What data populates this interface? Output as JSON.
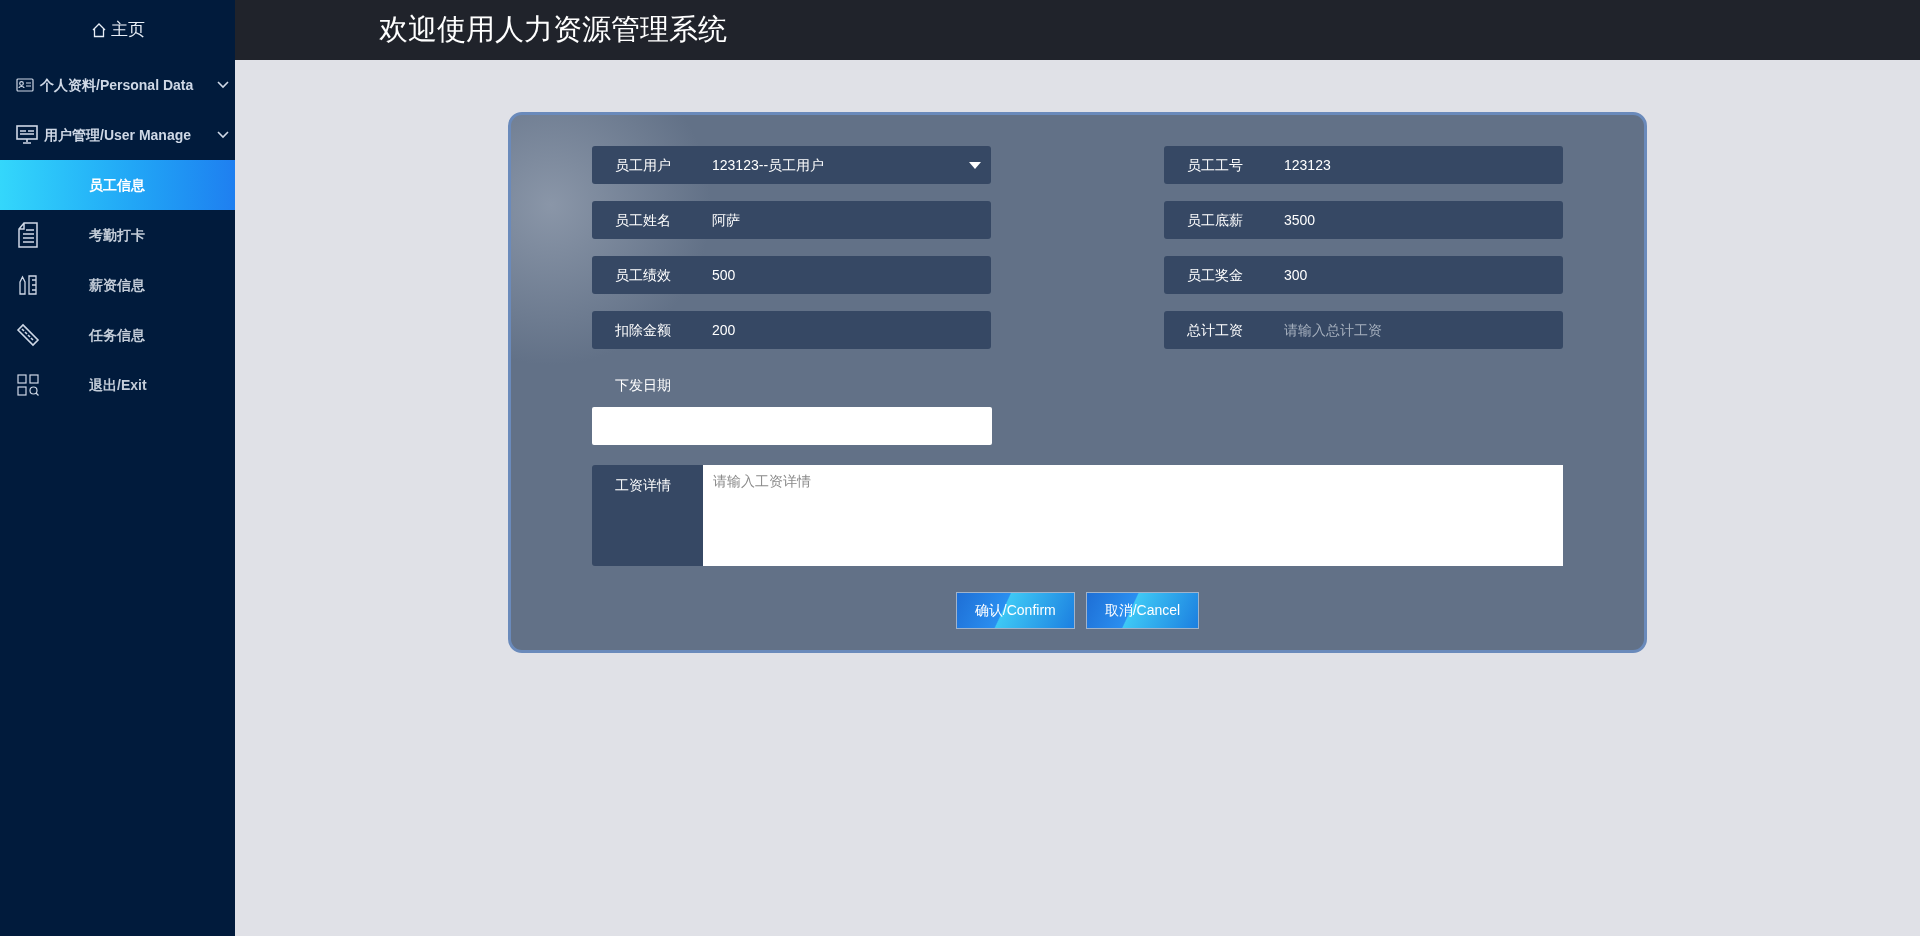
{
  "header": {
    "title": "欢迎使用人力资源管理系统"
  },
  "sidebar": {
    "home": "主页",
    "groups": [
      {
        "label": "个人资料/Personal Data"
      },
      {
        "label": "用户管理/User Manage",
        "children": [
          {
            "label": "员工信息",
            "selected": true
          },
          {
            "label": "考勤打卡",
            "selected": false
          },
          {
            "label": "薪资信息",
            "selected": false
          },
          {
            "label": "任务信息",
            "selected": false
          },
          {
            "label": "退出/Exit",
            "selected": false
          }
        ]
      }
    ]
  },
  "form": {
    "fields": [
      {
        "label": "员工用户",
        "kind": "select",
        "value": "123123--员工用户"
      },
      {
        "label": "员工工号",
        "kind": "input",
        "value": "123123"
      },
      {
        "label": "员工姓名",
        "kind": "input",
        "value": "阿萨"
      },
      {
        "label": "员工底薪",
        "kind": "input",
        "value": "3500"
      },
      {
        "label": "员工绩效",
        "kind": "input",
        "value": "500"
      },
      {
        "label": "员工奖金",
        "kind": "input",
        "value": "300"
      },
      {
        "label": "扣除金额",
        "kind": "input",
        "value": "200"
      },
      {
        "label": "总计工资",
        "kind": "input",
        "placeholder": "请输入总计工资"
      }
    ],
    "date": {
      "label": "下发日期"
    },
    "details": {
      "label": "工资详情",
      "placeholder": "请输入工资详情"
    },
    "buttons": [
      "确认/Confirm",
      "取消/Cancel"
    ]
  }
}
